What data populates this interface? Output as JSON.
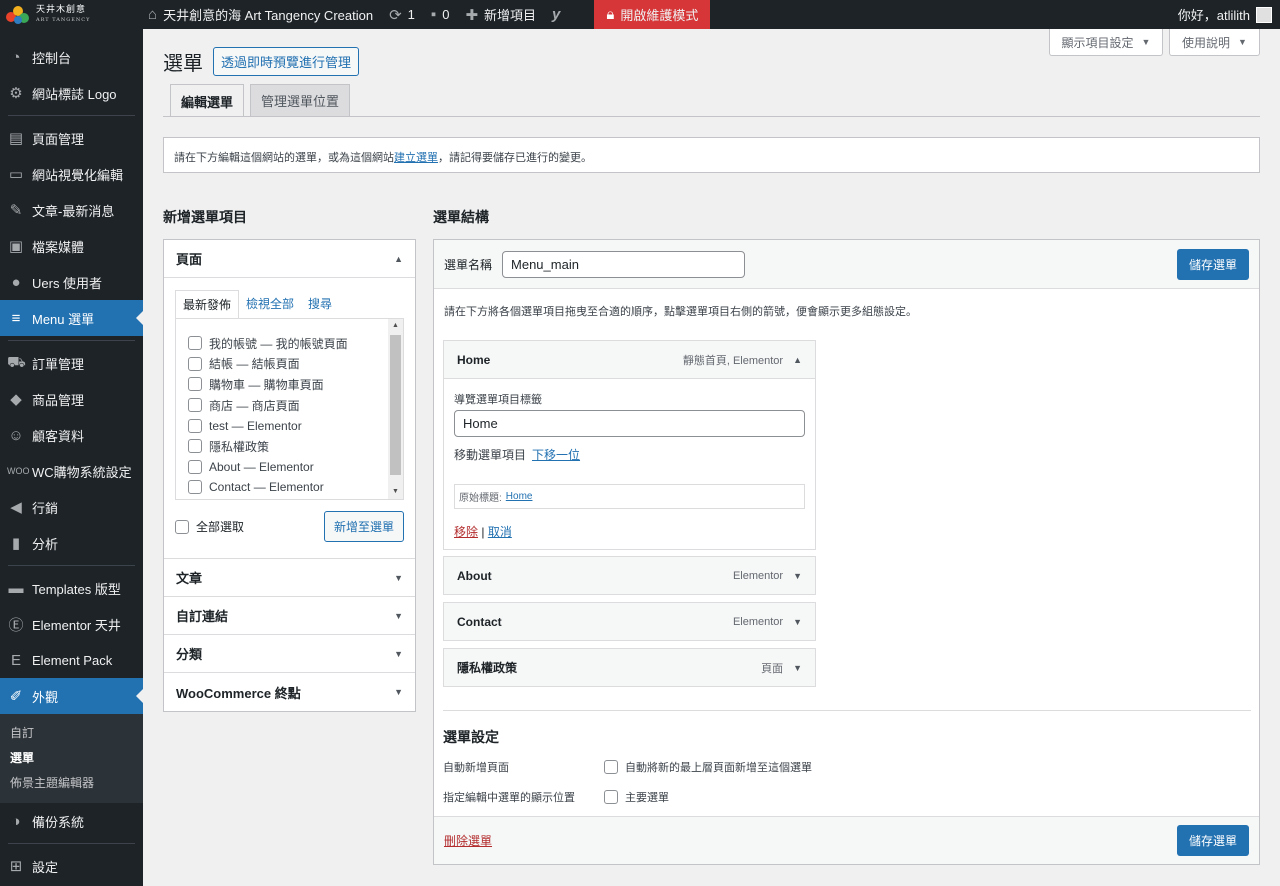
{
  "adminbar": {
    "logo_text": "天井木創意",
    "logo_sub": "ART TANGENCY",
    "site_name": "天井創意的海 Art Tangency Creation",
    "updates_count": "1",
    "comments_count": "0",
    "new_label": "新增項目",
    "recovery_label": "開啟維護模式",
    "greeting": "你好，atlilith"
  },
  "screen_meta": {
    "screen_options": "顯示項目設定",
    "help": "使用說明"
  },
  "sidebar": {
    "items": [
      {
        "label": "控制台",
        "icon": "dashboard-icon"
      },
      {
        "label": "網站標誌 Logo",
        "icon": "gear-icon"
      },
      {
        "label": "頁面管理",
        "icon": "pages-icon"
      },
      {
        "label": "網站視覺化編輯",
        "icon": "monitor-icon"
      },
      {
        "label": "文章-最新消息",
        "icon": "pin-icon"
      },
      {
        "label": "檔案媒體",
        "icon": "media-icon"
      },
      {
        "label": "Uers 使用者",
        "icon": "user-icon"
      },
      {
        "label": "Menu 選單",
        "icon": "menu-icon"
      },
      {
        "label": "訂單管理",
        "icon": "cart-icon"
      },
      {
        "label": "商品管理",
        "icon": "box-icon"
      },
      {
        "label": "顧客資料",
        "icon": "accessibility-icon"
      },
      {
        "label": "WC購物系統設定",
        "icon": "woo-icon"
      },
      {
        "label": "行銷",
        "icon": "megaphone-icon"
      },
      {
        "label": "分析",
        "icon": "bar-chart-icon"
      },
      {
        "label": "Templates 版型",
        "icon": "folder-icon"
      },
      {
        "label": "Elementor 天井",
        "icon": "elementor-icon"
      },
      {
        "label": "Element Pack",
        "icon": "element-pack-icon"
      },
      {
        "label": "外觀",
        "icon": "brush-icon"
      },
      {
        "label": "備份系統",
        "icon": "backup-icon"
      },
      {
        "label": "設定",
        "icon": "settings-icon"
      }
    ],
    "submenu": [
      "自訂",
      "選單",
      "佈景主題編輯器"
    ]
  },
  "page": {
    "title": "選單",
    "live_preview_btn": "透過即時預覽進行管理",
    "tabs": [
      "編輯選單",
      "管理選單位置"
    ],
    "notice_pre": "請在下方編輯這個網站的選單，或為這個網站",
    "notice_link": "建立選單",
    "notice_post": "，請記得要儲存已進行的變更。"
  },
  "add_items": {
    "heading": "新增選單項目",
    "pages_panel": "頁面",
    "inner_tabs": [
      "最新發佈",
      "檢視全部",
      "搜尋"
    ],
    "pages": [
      "我的帳號 — 我的帳號頁面",
      "結帳 — 結帳頁面",
      "購物車 — 購物車頁面",
      "商店 — 商店頁面",
      "test — Elementor",
      "隱私權政策",
      "About — Elementor",
      "Contact — Elementor"
    ],
    "select_all": "全部選取",
    "add_btn": "新增至選單",
    "panels": [
      "文章",
      "自訂連結",
      "分類",
      "WooCommerce 終點"
    ]
  },
  "structure": {
    "heading": "選單結構",
    "name_label": "選單名稱",
    "name_value": "Menu_main",
    "save_btn": "儲存選單",
    "desc": "請在下方將各個選單項目拖曳至合適的順序，點擊選單項目右側的箭號，便會顯示更多組態設定。",
    "items": [
      {
        "title": "Home",
        "type": "靜態首頁, Elementor"
      },
      {
        "title": "About",
        "type": "Elementor"
      },
      {
        "title": "Contact",
        "type": "Elementor"
      },
      {
        "title": "隱私權政策",
        "type": "頁面"
      }
    ],
    "expanded": {
      "nav_label": "導覽選單項目標籤",
      "nav_value": "Home",
      "move_label": "移動選單項目",
      "move_link": "下移一位",
      "orig_label": "原始標題:",
      "orig_link": "Home",
      "remove": "移除",
      "sep": "|",
      "cancel": "取消"
    },
    "settings": {
      "heading": "選單設定",
      "auto_add_label": "自動新增頁面",
      "auto_add_option": "自動將新的最上層頁面新增至這個選單",
      "location_label": "指定編輯中選單的顯示位置",
      "location_option": "主要選單"
    },
    "delete_menu": "刪除選單"
  },
  "colors": {
    "accent": "#2271b1",
    "sidebar_bg": "#1d2327",
    "danger": "#d63638"
  }
}
